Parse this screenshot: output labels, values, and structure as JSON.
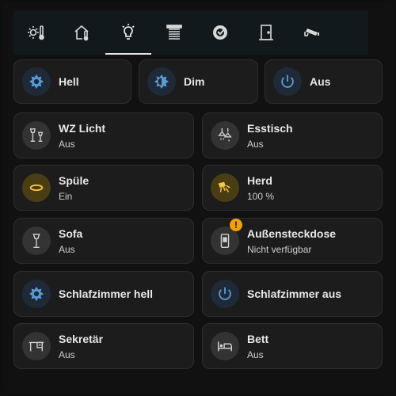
{
  "tabs": [
    {
      "icon": "sun-thermometer-icon",
      "active": false
    },
    {
      "icon": "home-thermometer-icon",
      "active": false
    },
    {
      "icon": "lightbulb-icon",
      "active": true
    },
    {
      "icon": "shutter-icon",
      "active": false
    },
    {
      "icon": "robot-vacuum-icon",
      "active": false
    },
    {
      "icon": "door-icon",
      "active": false
    },
    {
      "icon": "cctv-camera-icon",
      "active": false
    }
  ],
  "scenes": [
    {
      "label": "Hell",
      "icon": "brightness-high-icon"
    },
    {
      "label": "Dim",
      "icon": "brightness-half-icon"
    },
    {
      "label": "Aus",
      "icon": "power-icon"
    }
  ],
  "devices": [
    {
      "name": "WZ Licht",
      "state": "Aus",
      "icon": "floor-lamps-icon"
    },
    {
      "name": "Esstisch",
      "state": "Aus",
      "icon": "ceiling-lights-icon"
    },
    {
      "name": "Spüle",
      "state": "Ein",
      "icon": "ring-light-icon"
    },
    {
      "name": "Herd",
      "state": "100 %",
      "icon": "spotlight-beam-icon"
    },
    {
      "name": "Sofa",
      "state": "Aus",
      "icon": "floor-lamp-icon"
    },
    {
      "name": "Außensteckdose",
      "state": "Nicht verfügbar",
      "icon": "outdoor-socket-icon",
      "warning": "!"
    },
    {
      "name": "Schlafzimmer hell",
      "state": "",
      "icon": "brightness-high-icon"
    },
    {
      "name": "Schlafzimmer aus",
      "state": "",
      "icon": "power-icon"
    },
    {
      "name": "Sekretär",
      "state": "Aus",
      "icon": "desk-icon"
    },
    {
      "name": "Bett",
      "state": "Aus",
      "icon": "bed-icon"
    }
  ],
  "colors": {
    "accent_blue": "#5b9bd5",
    "active_yellow": "#f5c443",
    "warning_orange": "#f59f0a",
    "icon_grey": "#d0d0d0"
  }
}
